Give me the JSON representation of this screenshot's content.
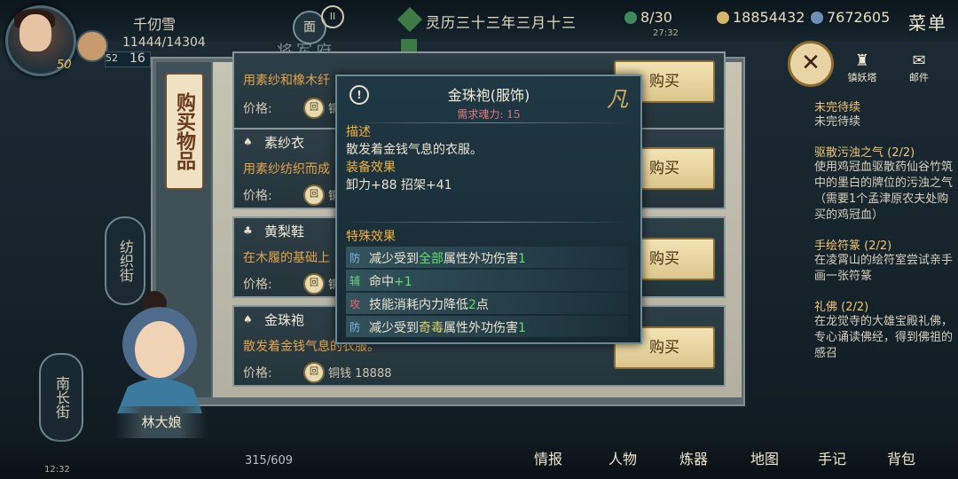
{
  "player": {
    "name": "千仞雪",
    "hp": "11444/14304",
    "level": "50",
    "mp_label": "52",
    "mp_value": "16"
  },
  "header": {
    "pause_icon": "pause-icon",
    "npc_badge": "面",
    "map_name": "将军府",
    "date": "灵历三十三年三月十三",
    "stamina": "8/30",
    "clock": "27:32",
    "copper": "18854432",
    "spirit": "7672605",
    "menu": "菜单"
  },
  "shop": {
    "tab_label": "购买物品",
    "buy_label": "购买",
    "price_label": "价格:",
    "items": [
      {
        "name": "",
        "desc": "用素纱和橡木纤",
        "price": "铜"
      },
      {
        "name": "素纱衣",
        "desc": "用素纱纺织而成",
        "price": "铜"
      },
      {
        "name": "黄梨鞋",
        "desc": "在木履的基础上",
        "price": "铜"
      },
      {
        "name": "金珠袍",
        "desc": "散发着金钱气息的衣服。",
        "price": "铜钱 18888"
      }
    ]
  },
  "tooltip": {
    "title": "金珠袍(服饰)",
    "requirement": "需求魂力: 15",
    "rarity": "凡",
    "desc_head": "描述",
    "desc": "散发着金钱气息的衣服。",
    "equip_head": "装备效果",
    "equip": "卸力+88  招架+41",
    "special_head": "特殊效果",
    "effects": [
      {
        "tag": "防",
        "pre": "减少受到",
        "hl": "全部",
        "post": "属性外功伤害",
        "num": "1",
        "tag_color": "#7fb7e8"
      },
      {
        "tag": "辅",
        "pre": "命中",
        "hl": "",
        "post": "",
        "num": "+1",
        "tag_color": "#6ad07a"
      },
      {
        "tag": "攻",
        "pre": "技能消耗内力降低",
        "hl": "",
        "post": "点",
        "num": "2",
        "tag_color": "#e86a6a"
      },
      {
        "tag": "防",
        "pre": "减少受到",
        "hl": "奇毒",
        "post": "属性外功伤害",
        "num": "1",
        "tag_color": "#7fb7e8"
      }
    ]
  },
  "side_icons": {
    "tower": "镇妖塔",
    "mail": "邮件"
  },
  "quests": [
    {
      "title": "未完待续",
      "text": "未完待续"
    },
    {
      "title": "驱散污浊之气 (2/2)",
      "text": "使用鸡冠血驱散药仙谷竹筑中的墨白的牌位的污浊之气（需要1个孟津原农夫处购买的鸡冠血）"
    },
    {
      "title": "手绘符篆 (2/2)",
      "text": "在凌霄山的绘符室尝试亲手画一张符篆"
    },
    {
      "title": "礼佛 (2/2)",
      "text": "在龙觉寺的大雄宝殿礼佛，专心诵读佛经，得到佛祖的感召"
    }
  ],
  "npc": {
    "name": "林大娘",
    "street": "南长街",
    "street2": "纺织街"
  },
  "bottom": {
    "bag": "315/609",
    "time": "12:32",
    "nav": [
      "情报",
      "人物",
      "炼器",
      "地图",
      "手记",
      "背包"
    ]
  },
  "colors": {
    "accent": "#f1b23b",
    "highlight": "#5fe06a",
    "panel": "#1f3844"
  }
}
